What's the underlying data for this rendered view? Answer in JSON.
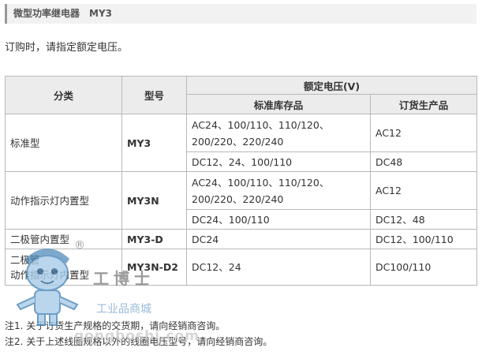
{
  "header": {
    "title": "微型功率继电器",
    "model": "MY3"
  },
  "intro": "订购时，请指定额定电压。",
  "table": {
    "headers": {
      "category": "分类",
      "model": "型号",
      "rated_voltage": "额定电压(V)",
      "standard_stock": "标准库存品",
      "order_product": "订货生产品"
    },
    "rows": [
      {
        "category": "标准型",
        "model": "MY3",
        "sub": [
          {
            "standard": "AC24、100/110、110/120、200/220、220/240",
            "order": "AC12"
          },
          {
            "standard": "DC12、24、100/110",
            "order": "DC48"
          }
        ]
      },
      {
        "category": "动作指示灯内置型",
        "model": "MY3N",
        "sub": [
          {
            "standard": "AC24、100/110、110/120、200/220、220/240",
            "order": "AC12"
          },
          {
            "standard": "DC24、100/110",
            "order": "DC12、48"
          }
        ]
      },
      {
        "category": "二极管内置型",
        "model": "MY3-D",
        "sub": [
          {
            "standard": "DC24",
            "order": "DC12、100/110"
          }
        ]
      },
      {
        "category_line1": "二极管",
        "category_line2": "动作指示灯内置型",
        "model": "MY3N-D2",
        "sub": [
          {
            "standard": "DC12、24",
            "order": "DC100/110"
          }
        ]
      }
    ]
  },
  "notes": [
    "注1. 关于订货生产规格的交货期，请向经销商咨询。",
    "注2. 关于上述线圈规格以外的线圈电压型号，请向经销商咨询。"
  ],
  "watermark": {
    "registered": "®",
    "brand": "工博士",
    "tagline": "工业品商城",
    "url": "gongboshi.com",
    "icon": "robot-mascot-icon",
    "colors": {
      "mascot_body": "#a8cde8",
      "mascot_outline": "#4a86b8",
      "tagline": "#8fb3d6"
    }
  }
}
